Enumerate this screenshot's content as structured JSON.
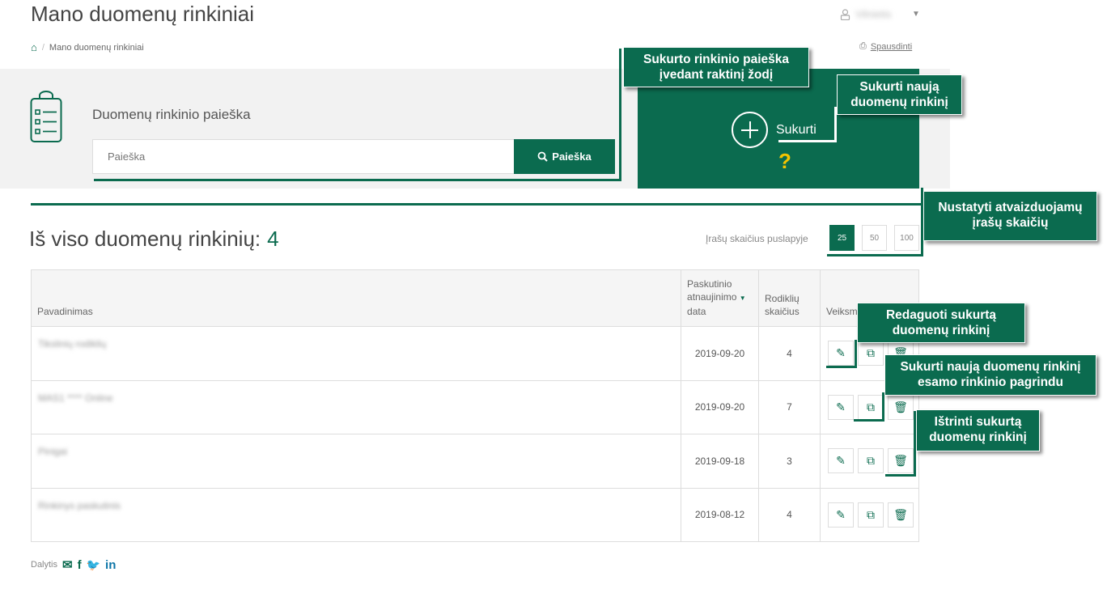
{
  "page": {
    "title": "Mano duomenų rinkiniai"
  },
  "user": {
    "name": "Vilnietis"
  },
  "breadcrumb": {
    "home_icon": "home-icon",
    "current": "Mano duomenų rinkiniai"
  },
  "print": {
    "label": "Spausdinti"
  },
  "search": {
    "label": "Duomenų rinkinio paieška",
    "placeholder": "Paieška",
    "button": "Paieška"
  },
  "create": {
    "label": "Sukurti",
    "help": "?"
  },
  "callouts": {
    "search": [
      "Sukurto rinkinio paieška",
      "įvedant raktinį žodį"
    ],
    "create": [
      "Sukurti naują",
      "duomenų rinkinį"
    ],
    "perpage": [
      "Nustatyti atvaizduojamų",
      "įrašų skaičių"
    ],
    "edit": [
      "Redaguoti sukurtą",
      "duomenų rinkinį"
    ],
    "copy": [
      "Sukurti naują duomenų rinkinį",
      "esamo rinkinio pagrindu"
    ],
    "delete": [
      "Ištrinti sukurtą",
      "duomenų rinkinį"
    ]
  },
  "summary": {
    "label": "Iš viso duomenų rinkinių:",
    "count": "4"
  },
  "pagination": {
    "label": "Įrašų skaičius puslapyje",
    "options": [
      "25",
      "50",
      "100"
    ],
    "selected": "25"
  },
  "table": {
    "headers": {
      "name": "Pavadinimas",
      "date": [
        "Paskutinio",
        "atnaujinimo",
        "data"
      ],
      "indicators": [
        "Rodiklių",
        "skaičius"
      ],
      "actions": "Veiksmai"
    },
    "rows": [
      {
        "name": "Tikslinių rodiklių",
        "date": "2019-09-20",
        "indicators": "4"
      },
      {
        "name": "MAS1 **** Online",
        "date": "2019-09-20",
        "indicators": "7"
      },
      {
        "name": "Pinigai",
        "date": "2019-09-18",
        "indicators": "3"
      },
      {
        "name": "Rinkinys paskutinis",
        "date": "2019-08-12",
        "indicators": "4"
      }
    ]
  },
  "share": {
    "label": "Dalytis"
  },
  "colors": {
    "accent": "#0b6b4f",
    "help": "#f5c400"
  }
}
